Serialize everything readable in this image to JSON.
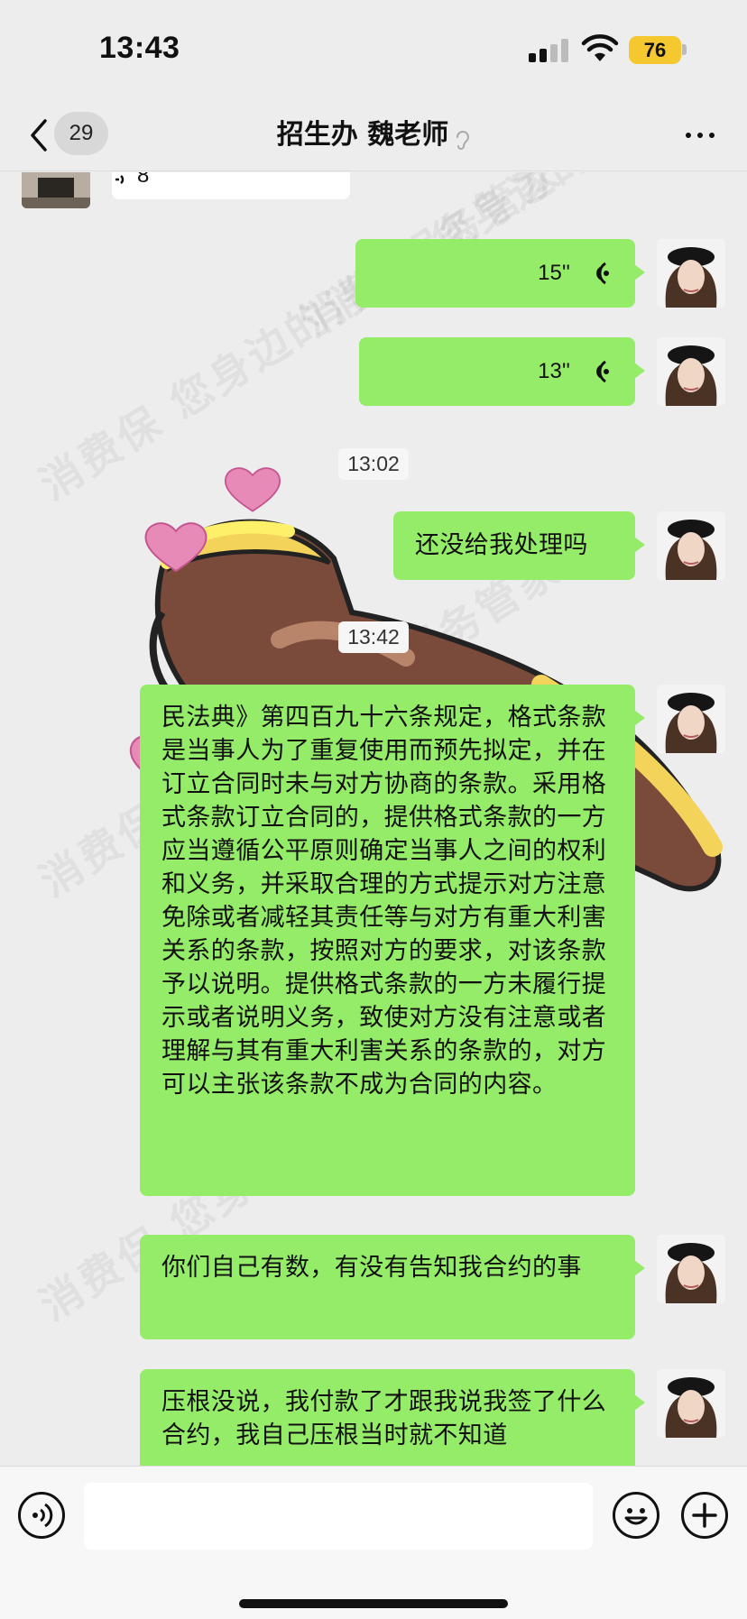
{
  "status_bar": {
    "time": "13:43",
    "battery_level": "76"
  },
  "nav": {
    "back_count": "29",
    "title": "招生办 魏老师"
  },
  "messages": {
    "top_voice_partial": "8''",
    "voice1_duration": "15''",
    "voice2_duration": "13''",
    "time1": "13:02",
    "text1": "还没给我处理吗",
    "time2": "13:42",
    "text2": "民法典》第四百九十六条规定，格式条款是当事人为了重复使用而预先拟定，并在订立合同时未与对方协商的条款。采用格式条款订立合同的，提供格式条款的一方应当遵循公平原则确定当事人之间的权利和义务，并采取合理的方式提示对方注意免除或者减轻其责任等与对方有重大利害关系的条款，按照对方的要求，对该条款予以说明。提供格式条款的一方未履行提示或者说明义务，致使对方没有注意或者理解与其有重大利害关系的条款的，对方可以主张该条款不成为合同的内容。",
    "text3": "你们自己有数，有没有告知我合约的事",
    "text4": "压根没说，我付款了才跟我说我签了什么合约，我自己压根当时就不知道"
  },
  "watermark": "消费保 您身边的消费服务管家",
  "input": {
    "placeholder": ""
  },
  "colors": {
    "sent_bubble": "#95ec69",
    "received_bubble": "#ffffff",
    "background": "#ededed",
    "battery": "#f6c830"
  }
}
